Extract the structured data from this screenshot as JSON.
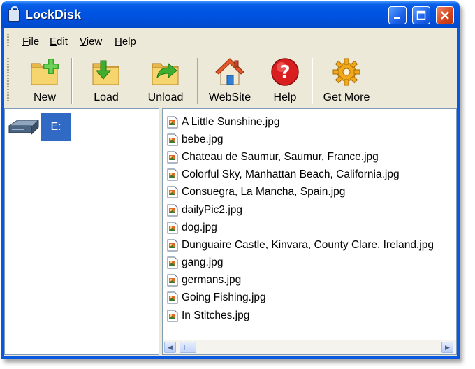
{
  "window": {
    "title": "LockDisk",
    "title_icon": "lock-icon"
  },
  "titlebar_buttons": {
    "minimize": "minimize",
    "maximize": "maximize",
    "close": "close"
  },
  "menu": [
    {
      "label": "File",
      "mnemonic": "F",
      "rest": "ile"
    },
    {
      "label": "Edit",
      "mnemonic": "E",
      "rest": "dit"
    },
    {
      "label": "View",
      "mnemonic": "V",
      "rest": "iew"
    },
    {
      "label": "Help",
      "mnemonic": "H",
      "rest": "elp"
    }
  ],
  "toolbar": {
    "new_label": "New",
    "load_label": "Load",
    "unload_label": "Unload",
    "website_label": "WebSite",
    "help_label": "Help",
    "getmore_label": "Get More"
  },
  "tree": {
    "drive_label": "E:"
  },
  "files": [
    "A Little Sunshine.jpg",
    "bebe.jpg",
    "Chateau de Saumur, Saumur, France.jpg",
    "Colorful Sky, Manhattan Beach, California.jpg",
    "Consuegra, La Mancha, Spain.jpg",
    "dailyPic2.jpg",
    "dog.jpg",
    "Dunguaire Castle, Kinvara, County Clare, Ireland.jpg",
    "gang.jpg",
    "germans.jpg",
    "Going Fishing.jpg",
    "In Stitches.jpg"
  ],
  "colors": {
    "titlebar": "#0054e3",
    "selection": "#316ac5",
    "frame": "#ece9d8"
  }
}
